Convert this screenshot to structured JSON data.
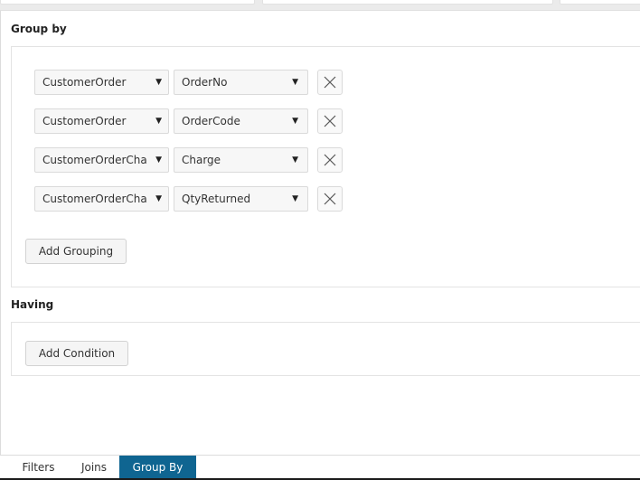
{
  "group_by": {
    "title": "Group by",
    "rows": [
      {
        "table": "CustomerOrder",
        "column": "OrderNo"
      },
      {
        "table": "CustomerOrder",
        "column": "OrderCode"
      },
      {
        "table": "CustomerOrderCha",
        "column": "Charge"
      },
      {
        "table": "CustomerOrderCha",
        "column": "QtyReturned"
      }
    ],
    "add_button": "Add Grouping"
  },
  "having": {
    "title": "Having",
    "add_button": "Add Condition"
  },
  "tabs": [
    {
      "label": "Filters",
      "active": false
    },
    {
      "label": "Joins",
      "active": false
    },
    {
      "label": "Group By",
      "active": true
    }
  ],
  "icons": {
    "caret": "▼",
    "remove": "close-x"
  },
  "colors": {
    "active_tab": "#0f6591"
  }
}
